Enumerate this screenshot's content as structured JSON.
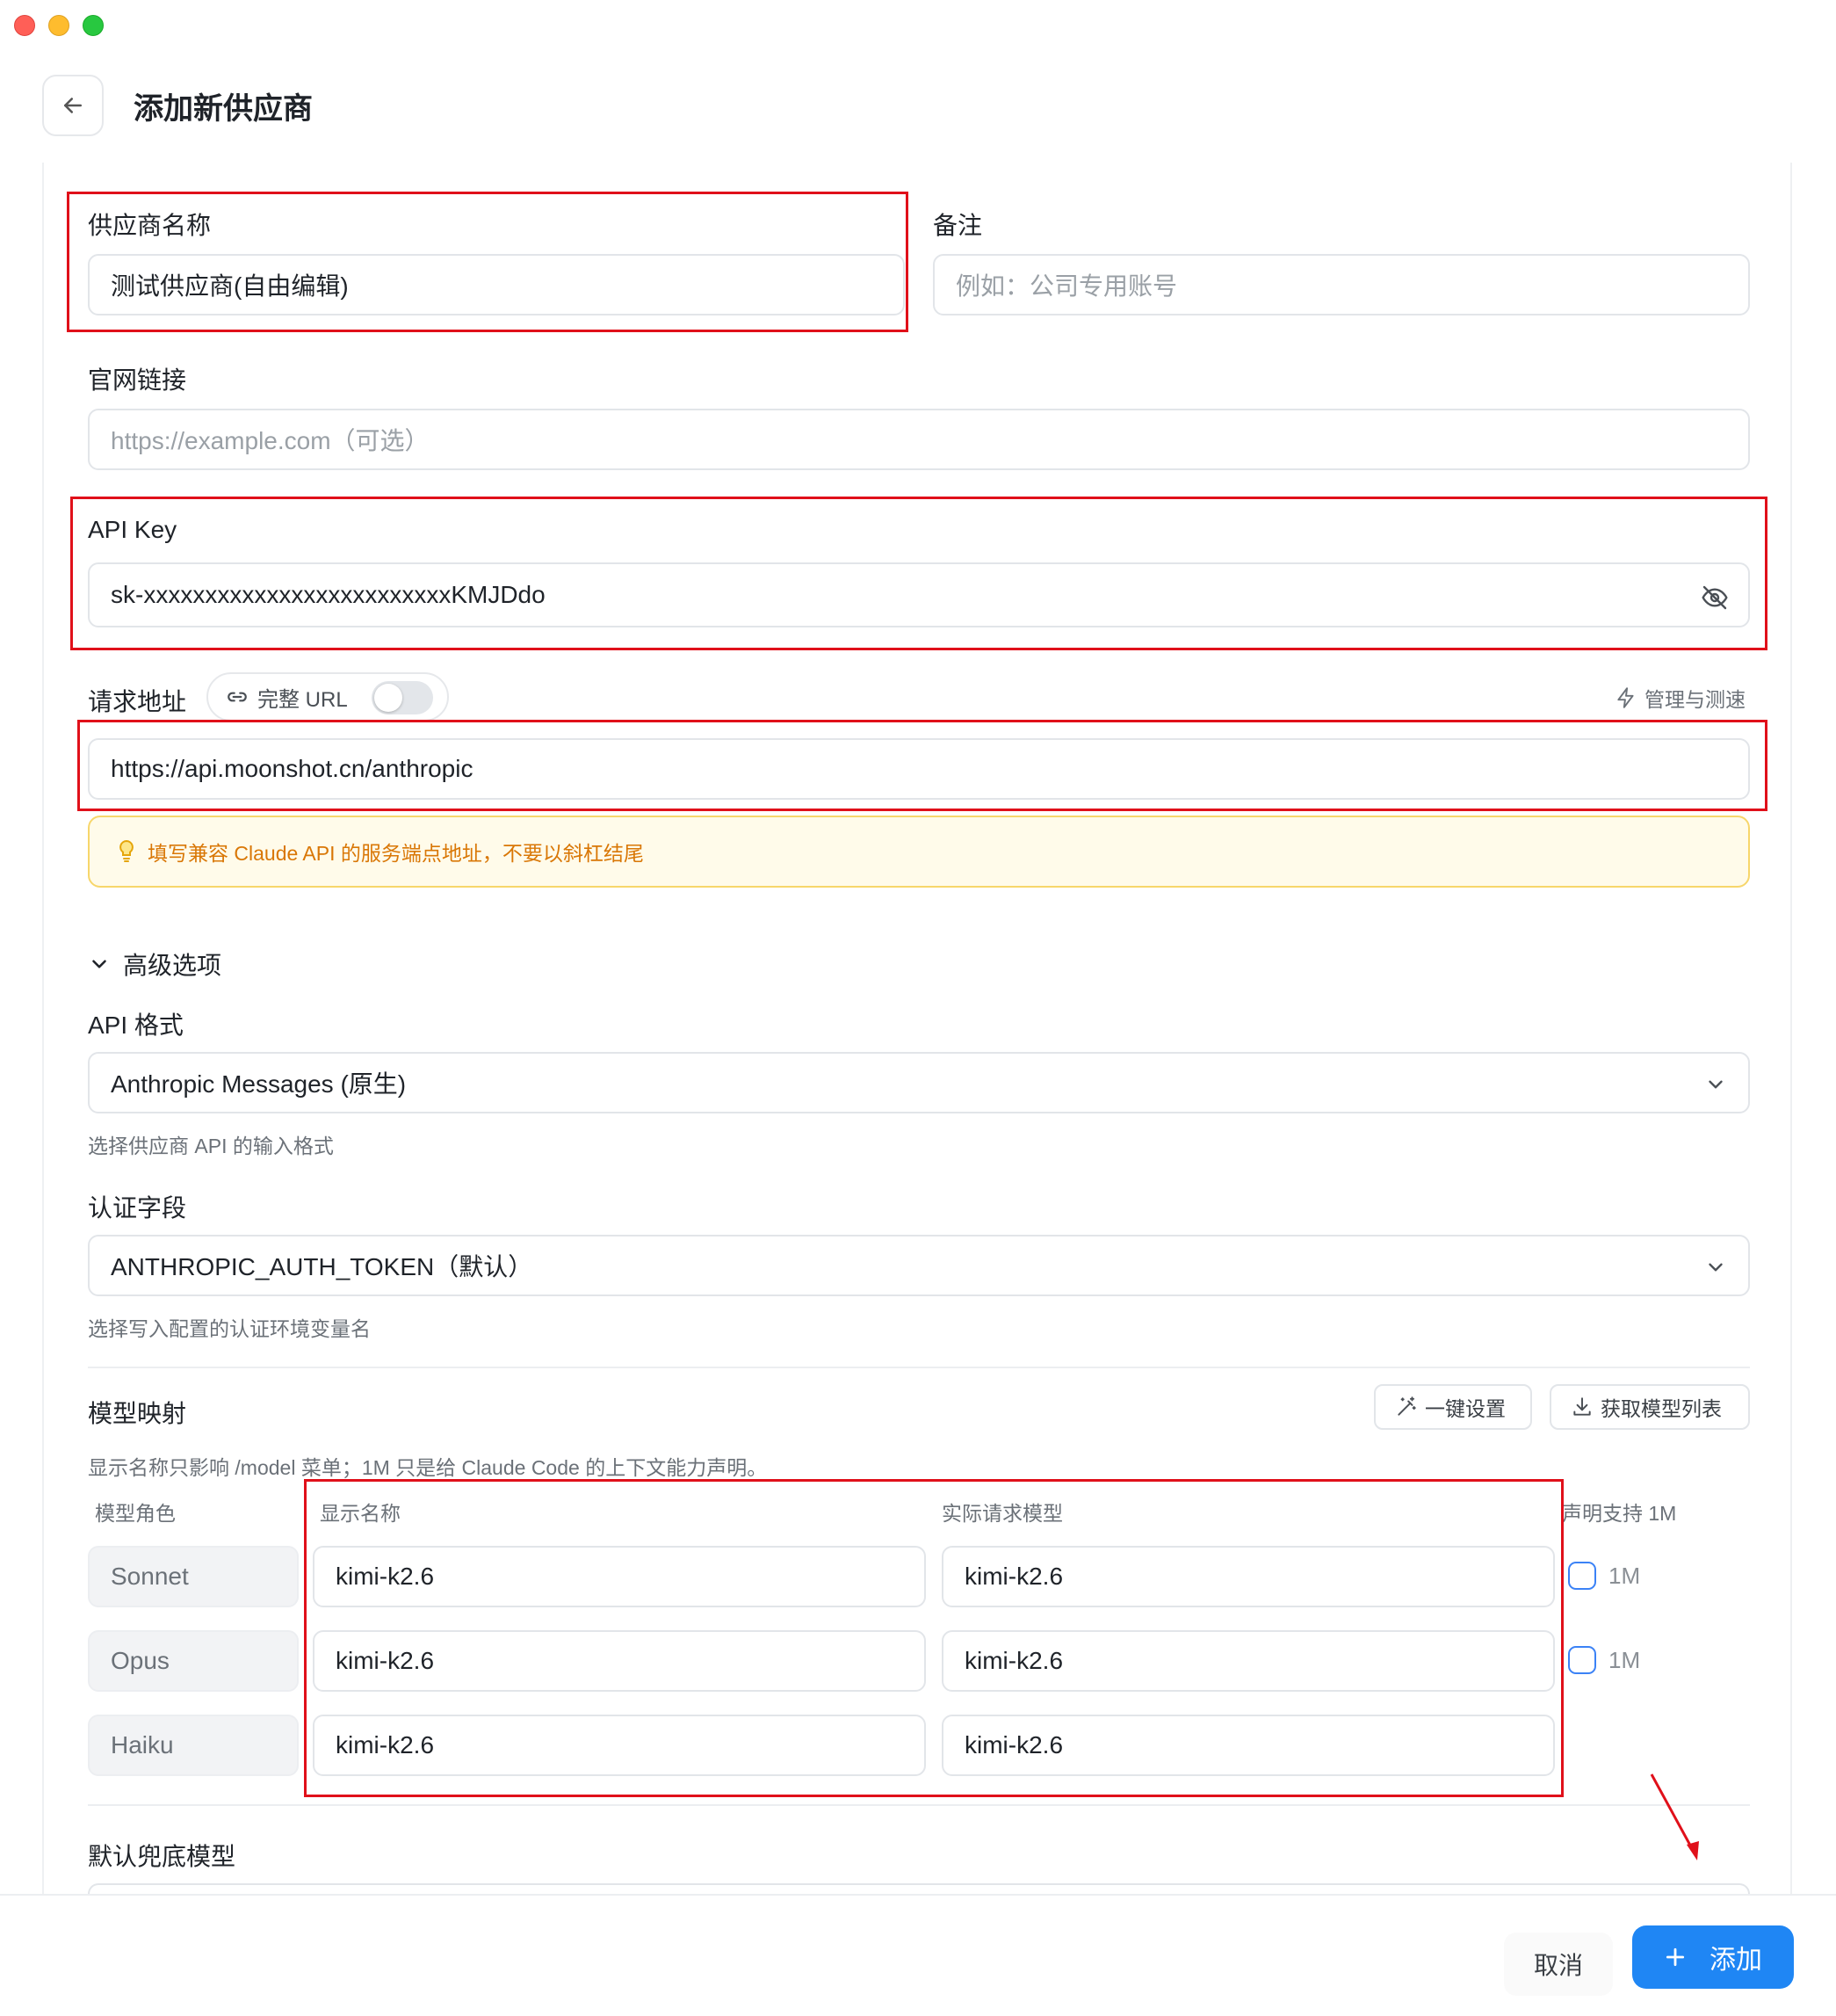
{
  "header": {
    "title": "添加新供应商"
  },
  "form": {
    "provider_name": {
      "label": "供应商名称",
      "value": "测试供应商(自由编辑)"
    },
    "note": {
      "label": "备注",
      "placeholder": "例如：公司专用账号"
    },
    "website": {
      "label": "官网链接",
      "placeholder": "https://example.com（可选）"
    },
    "api_key": {
      "label": "API Key",
      "value": "sk-xxxxxxxxxxxxxxxxxxxxxxxxxKMJDdo"
    },
    "endpoint": {
      "label": "请求地址",
      "full_url_label": "完整 URL",
      "full_url_enabled": false,
      "manage_label": "管理与测速",
      "value": "https://api.moonshot.cn/anthropic",
      "tip": "填写兼容 Claude API 的服务端点地址，不要以斜杠结尾"
    }
  },
  "advanced": {
    "toggle_label": "高级选项",
    "api_format": {
      "label": "API 格式",
      "value": "Anthropic Messages (原生)",
      "helper": "选择供应商 API 的输入格式"
    },
    "auth_field": {
      "label": "认证字段",
      "value": "ANTHROPIC_AUTH_TOKEN（默认）",
      "helper": "选择写入配置的认证环境变量名"
    }
  },
  "model_mapping": {
    "title": "模型映射",
    "one_click_label": "一键设置",
    "fetch_label": "获取模型列表",
    "description": "显示名称只影响 /model 菜单；1M 只是给 Claude Code 的上下文能力声明。",
    "columns": {
      "role": "模型角色",
      "display": "显示名称",
      "actual": "实际请求模型",
      "declare": "声明支持 1M"
    },
    "rows": [
      {
        "role": "Sonnet",
        "display": "kimi-k2.6",
        "actual": "kimi-k2.6",
        "onem_label": "1M",
        "onem": false
      },
      {
        "role": "Opus",
        "display": "kimi-k2.6",
        "actual": "kimi-k2.6",
        "onem_label": "1M",
        "onem": false
      },
      {
        "role": "Haiku",
        "display": "kimi-k2.6",
        "actual": "kimi-k2.6"
      }
    ]
  },
  "fallback": {
    "label": "默认兜底模型"
  },
  "footer": {
    "cancel_label": "取消",
    "add_label": "添加"
  },
  "colors": {
    "accent": "#1f86f4",
    "annotation": "#e0101a",
    "tip_text": "#d97706",
    "tip_bg": "#fffbea"
  },
  "icons": [
    "back-arrow-icon",
    "eye-off-icon",
    "link-icon",
    "lightning-icon",
    "lightbulb-icon",
    "chevron-down-icon",
    "magic-wand-icon",
    "download-icon",
    "plus-icon"
  ]
}
